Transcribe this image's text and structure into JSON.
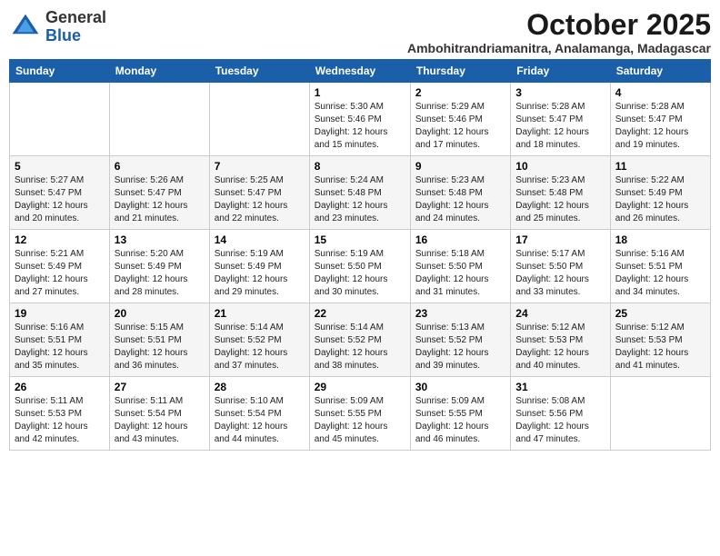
{
  "header": {
    "logo_general": "General",
    "logo_blue": "Blue",
    "month_title": "October 2025",
    "location": "Ambohitrandriamanitra, Analamanga, Madagascar"
  },
  "weekdays": [
    "Sunday",
    "Monday",
    "Tuesday",
    "Wednesday",
    "Thursday",
    "Friday",
    "Saturday"
  ],
  "weeks": [
    [
      {
        "day": "",
        "info": ""
      },
      {
        "day": "",
        "info": ""
      },
      {
        "day": "",
        "info": ""
      },
      {
        "day": "1",
        "info": "Sunrise: 5:30 AM\nSunset: 5:46 PM\nDaylight: 12 hours\nand 15 minutes."
      },
      {
        "day": "2",
        "info": "Sunrise: 5:29 AM\nSunset: 5:46 PM\nDaylight: 12 hours\nand 17 minutes."
      },
      {
        "day": "3",
        "info": "Sunrise: 5:28 AM\nSunset: 5:47 PM\nDaylight: 12 hours\nand 18 minutes."
      },
      {
        "day": "4",
        "info": "Sunrise: 5:28 AM\nSunset: 5:47 PM\nDaylight: 12 hours\nand 19 minutes."
      }
    ],
    [
      {
        "day": "5",
        "info": "Sunrise: 5:27 AM\nSunset: 5:47 PM\nDaylight: 12 hours\nand 20 minutes."
      },
      {
        "day": "6",
        "info": "Sunrise: 5:26 AM\nSunset: 5:47 PM\nDaylight: 12 hours\nand 21 minutes."
      },
      {
        "day": "7",
        "info": "Sunrise: 5:25 AM\nSunset: 5:47 PM\nDaylight: 12 hours\nand 22 minutes."
      },
      {
        "day": "8",
        "info": "Sunrise: 5:24 AM\nSunset: 5:48 PM\nDaylight: 12 hours\nand 23 minutes."
      },
      {
        "day": "9",
        "info": "Sunrise: 5:23 AM\nSunset: 5:48 PM\nDaylight: 12 hours\nand 24 minutes."
      },
      {
        "day": "10",
        "info": "Sunrise: 5:23 AM\nSunset: 5:48 PM\nDaylight: 12 hours\nand 25 minutes."
      },
      {
        "day": "11",
        "info": "Sunrise: 5:22 AM\nSunset: 5:49 PM\nDaylight: 12 hours\nand 26 minutes."
      }
    ],
    [
      {
        "day": "12",
        "info": "Sunrise: 5:21 AM\nSunset: 5:49 PM\nDaylight: 12 hours\nand 27 minutes."
      },
      {
        "day": "13",
        "info": "Sunrise: 5:20 AM\nSunset: 5:49 PM\nDaylight: 12 hours\nand 28 minutes."
      },
      {
        "day": "14",
        "info": "Sunrise: 5:19 AM\nSunset: 5:49 PM\nDaylight: 12 hours\nand 29 minutes."
      },
      {
        "day": "15",
        "info": "Sunrise: 5:19 AM\nSunset: 5:50 PM\nDaylight: 12 hours\nand 30 minutes."
      },
      {
        "day": "16",
        "info": "Sunrise: 5:18 AM\nSunset: 5:50 PM\nDaylight: 12 hours\nand 31 minutes."
      },
      {
        "day": "17",
        "info": "Sunrise: 5:17 AM\nSunset: 5:50 PM\nDaylight: 12 hours\nand 33 minutes."
      },
      {
        "day": "18",
        "info": "Sunrise: 5:16 AM\nSunset: 5:51 PM\nDaylight: 12 hours\nand 34 minutes."
      }
    ],
    [
      {
        "day": "19",
        "info": "Sunrise: 5:16 AM\nSunset: 5:51 PM\nDaylight: 12 hours\nand 35 minutes."
      },
      {
        "day": "20",
        "info": "Sunrise: 5:15 AM\nSunset: 5:51 PM\nDaylight: 12 hours\nand 36 minutes."
      },
      {
        "day": "21",
        "info": "Sunrise: 5:14 AM\nSunset: 5:52 PM\nDaylight: 12 hours\nand 37 minutes."
      },
      {
        "day": "22",
        "info": "Sunrise: 5:14 AM\nSunset: 5:52 PM\nDaylight: 12 hours\nand 38 minutes."
      },
      {
        "day": "23",
        "info": "Sunrise: 5:13 AM\nSunset: 5:52 PM\nDaylight: 12 hours\nand 39 minutes."
      },
      {
        "day": "24",
        "info": "Sunrise: 5:12 AM\nSunset: 5:53 PM\nDaylight: 12 hours\nand 40 minutes."
      },
      {
        "day": "25",
        "info": "Sunrise: 5:12 AM\nSunset: 5:53 PM\nDaylight: 12 hours\nand 41 minutes."
      }
    ],
    [
      {
        "day": "26",
        "info": "Sunrise: 5:11 AM\nSunset: 5:53 PM\nDaylight: 12 hours\nand 42 minutes."
      },
      {
        "day": "27",
        "info": "Sunrise: 5:11 AM\nSunset: 5:54 PM\nDaylight: 12 hours\nand 43 minutes."
      },
      {
        "day": "28",
        "info": "Sunrise: 5:10 AM\nSunset: 5:54 PM\nDaylight: 12 hours\nand 44 minutes."
      },
      {
        "day": "29",
        "info": "Sunrise: 5:09 AM\nSunset: 5:55 PM\nDaylight: 12 hours\nand 45 minutes."
      },
      {
        "day": "30",
        "info": "Sunrise: 5:09 AM\nSunset: 5:55 PM\nDaylight: 12 hours\nand 46 minutes."
      },
      {
        "day": "31",
        "info": "Sunrise: 5:08 AM\nSunset: 5:56 PM\nDaylight: 12 hours\nand 47 minutes."
      },
      {
        "day": "",
        "info": ""
      }
    ]
  ]
}
